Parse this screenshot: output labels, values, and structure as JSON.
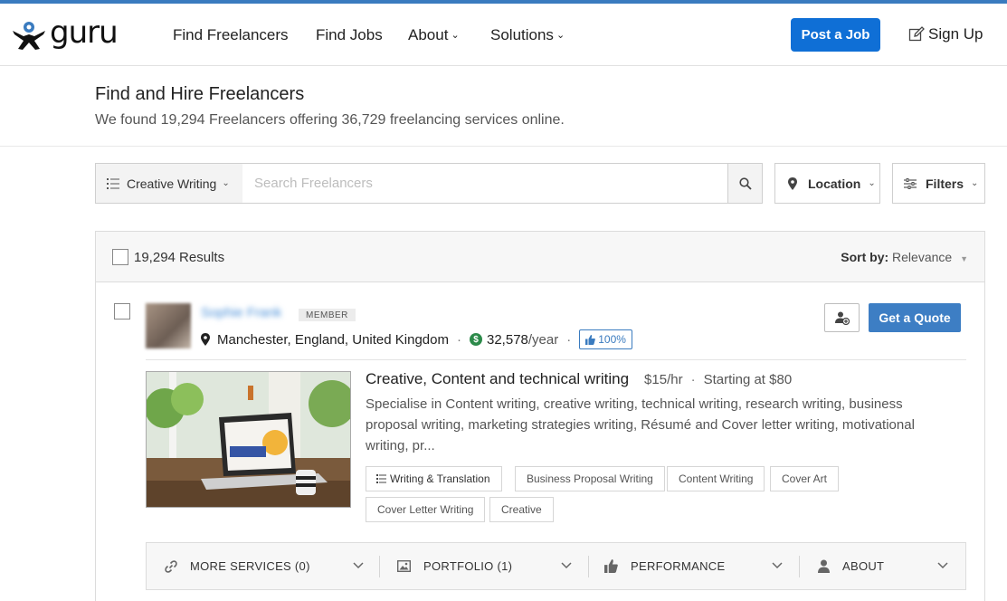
{
  "header": {
    "logo_text": "guru",
    "nav": [
      "Find Freelancers",
      "Find Jobs",
      "About",
      "Solutions"
    ],
    "post_job": "Post a Job",
    "sign_up": "Sign Up",
    "brand_color": "#3a7bbf"
  },
  "hero": {
    "title": "Find and Hire Freelancers",
    "subtitle": "We found 19,294 Freelancers offering 36,729 freelancing services online."
  },
  "search": {
    "category": "Creative Writing",
    "placeholder": "Search Freelancers",
    "location": "Location",
    "filters": "Filters"
  },
  "results": {
    "count": "19,294 Results",
    "sort_label": "Sort by:",
    "sort_value": "Relevance"
  },
  "freelancer": {
    "name": "Sophie Frank",
    "badge": "MEMBER",
    "location": "Manchester, England, United Kingdom",
    "earnings": "32,578",
    "earnings_period": "/year",
    "rating": "100%",
    "get_quote": "Get a Quote",
    "service": {
      "title": "Creative, Content and technical writing",
      "rate": "$15/hr",
      "starting": "Starting at $80",
      "description": "Specialise in Content writing, creative writing, technical writing, research writing, business proposal writing, marketing strategies writing, Résumé and Cover letter writing, motivational writing, pr...",
      "tags": [
        "Writing & Translation",
        "Business Proposal Writing",
        "Content Writing",
        "Cover Art",
        "Cover Letter Writing",
        "Creative"
      ]
    },
    "sections": [
      "MORE SERVICES (0)",
      "PORTFOLIO (1)",
      "PERFORMANCE",
      "ABOUT"
    ]
  }
}
